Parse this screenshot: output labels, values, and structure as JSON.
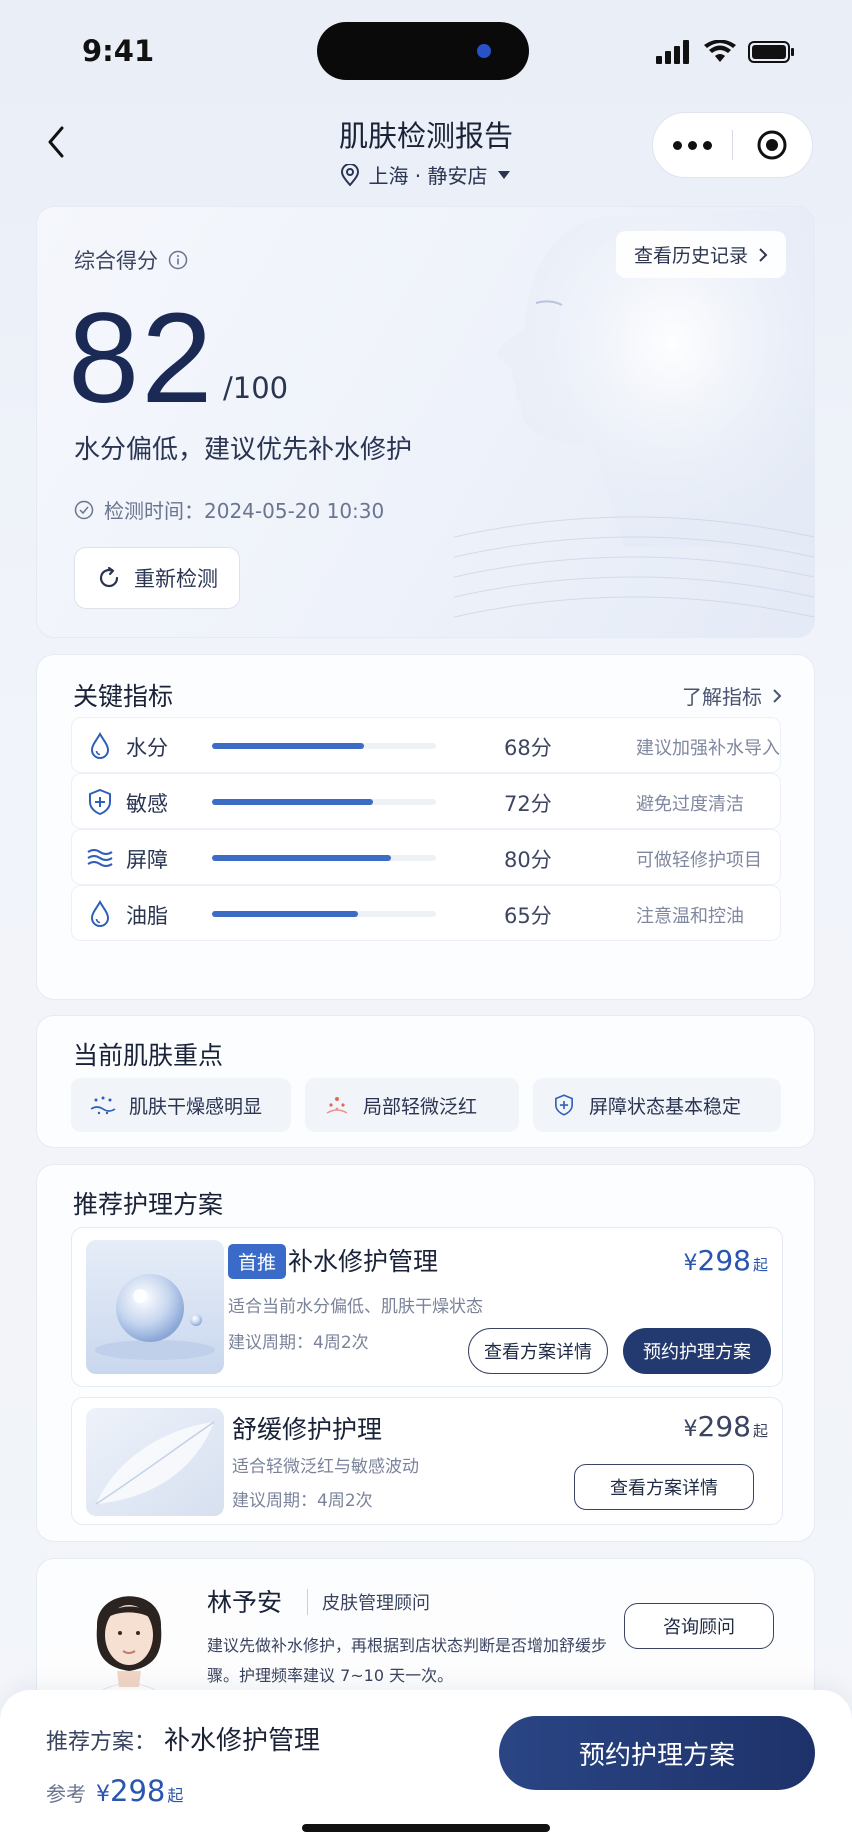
{
  "status_bar": {
    "time": "9:41"
  },
  "nav": {
    "title": "肌肤检测报告",
    "location": "上海 · 静安店"
  },
  "score_card": {
    "label": "综合得分",
    "history_button": "查看历史记录",
    "score": "82",
    "max": "/100",
    "summary": "水分偏低，建议优先补水修护",
    "time_label": "检测时间：",
    "time_value": "2024-05-20 10:30",
    "redo_button": "重新检测"
  },
  "metrics": {
    "title": "关键指标",
    "more_link": "了解指标",
    "items": [
      {
        "icon": "droplet-icon",
        "name": "水分",
        "value": 68,
        "value_text": "68分",
        "tip": "建议加强补水导入"
      },
      {
        "icon": "shield-plus-icon",
        "name": "敏感",
        "value": 72,
        "value_text": "72分",
        "tip": "避免过度清洁"
      },
      {
        "icon": "waves-icon",
        "name": "屏障",
        "value": 80,
        "value_text": "80分",
        "tip": "可做轻修护项目"
      },
      {
        "icon": "droplet-icon",
        "name": "油脂",
        "value": 65,
        "value_text": "65分",
        "tip": "注意温和控油"
      }
    ]
  },
  "focus": {
    "title": "当前肌肤重点",
    "chips": [
      {
        "icon": "dry-skin-icon",
        "label": "肌肤干燥感明显"
      },
      {
        "icon": "redness-icon",
        "label": "局部轻微泛红"
      },
      {
        "icon": "shield-plus-icon",
        "label": "屏障状态基本稳定"
      }
    ]
  },
  "plans": {
    "title": "推荐护理方案",
    "items": [
      {
        "badge": "首推",
        "name": "补水修护管理",
        "desc": "适合当前水分偏低、肌肤干燥状态",
        "cycle": "建议周期：4周2次",
        "currency": "¥",
        "price": "298",
        "price_suffix": "起",
        "detail_button": "查看方案详情",
        "book_button": "预约护理方案"
      },
      {
        "name": "舒缓修护护理",
        "desc": "适合轻微泛红与敏感波动",
        "cycle": "建议周期：4周2次",
        "currency": "¥",
        "price": "298",
        "price_suffix": "起",
        "detail_button": "查看方案详情"
      }
    ]
  },
  "advisor": {
    "name": "林予安",
    "role": "皮肤管理顾问",
    "text": "建议先做补水修护，再根据到店状态判断是否增加舒缓步骤。护理频率建议 7~10 天一次。",
    "button": "咨询顾问"
  },
  "bottom_bar": {
    "label": "推荐方案：",
    "plan_name": "补水修护管理",
    "ref_label": "参考",
    "currency": "¥",
    "price": "298",
    "price_suffix": "起",
    "button": "预约护理方案"
  },
  "colors": {
    "accent": "#3d6cc4",
    "primary_dark": "#233a70",
    "price": "#2a56b0"
  }
}
